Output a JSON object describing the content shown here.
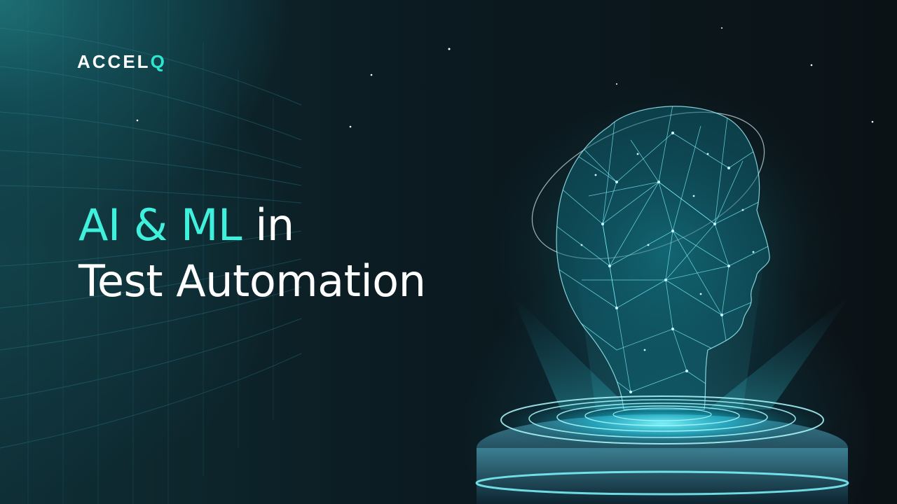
{
  "brand": {
    "logo_main": "ACCEL",
    "logo_accent": "Q"
  },
  "headline": {
    "highlight": "AI & ML",
    "rest": " in",
    "line2": "Test Automation"
  },
  "colors": {
    "accent": "#3ff0dc",
    "text": "#ffffff",
    "background": "#0b1216",
    "hologram": "#22e5f0"
  },
  "icons": {
    "hero": "wireframe-head-hologram-icon"
  }
}
